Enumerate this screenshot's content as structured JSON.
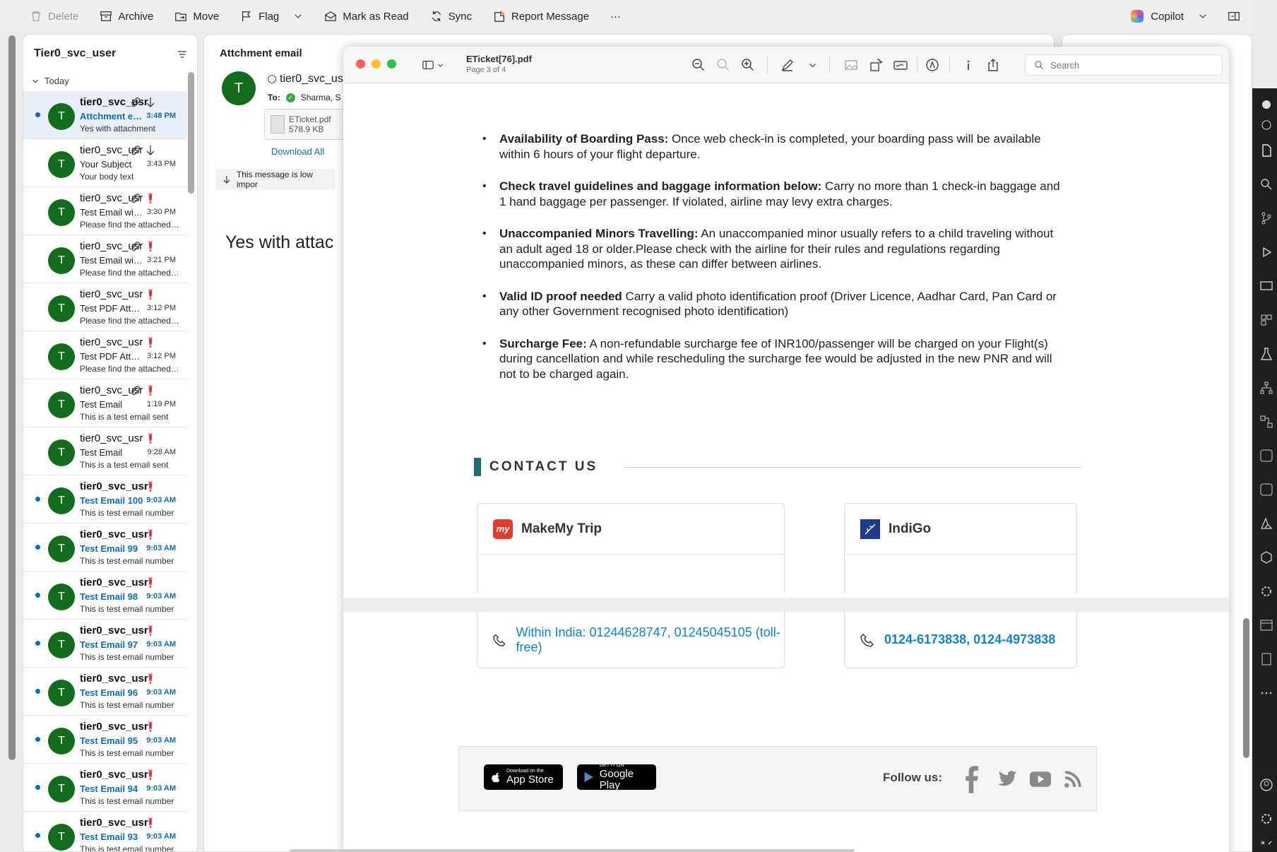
{
  "toolbar": {
    "delete": "Delete",
    "archive": "Archive",
    "move": "Move",
    "flag": "Flag",
    "mark_read": "Mark as Read",
    "sync": "Sync",
    "report": "Report Message",
    "more": "···",
    "copilot": "Copilot"
  },
  "list": {
    "title": "Tier0_svc_user",
    "group": "Today",
    "items": [
      {
        "sender": "tier0_svc_usr",
        "subject": "Attchment email",
        "time": "3:48 PM",
        "preview": "Yes with attachment",
        "unread": true,
        "selected": true,
        "attach": true,
        "download": true,
        "important": false
      },
      {
        "sender": "tier0_svc_usr",
        "subject": "Your Subject",
        "time": "3:43 PM",
        "preview": "Your body text",
        "unread": false,
        "selected": false,
        "attach": true,
        "download": true,
        "important": false
      },
      {
        "sender": "tier0_svc_usr",
        "subject": "Test Email with attachment",
        "time": "3:30 PM",
        "preview": "Please find the attached file",
        "unread": false,
        "selected": false,
        "attach": true,
        "download": false,
        "important": true
      },
      {
        "sender": "tier0_svc_usr",
        "subject": "Test Email with attachment",
        "time": "3:21 PM",
        "preview": "Please find the attached file",
        "unread": false,
        "selected": false,
        "attach": true,
        "download": false,
        "important": true
      },
      {
        "sender": "tier0_svc_usr",
        "subject": "Test PDF Attachment",
        "time": "3:12 PM",
        "preview": "Please find the attached file",
        "unread": false,
        "selected": false,
        "attach": false,
        "download": false,
        "important": true
      },
      {
        "sender": "tier0_svc_usr",
        "subject": "Test PDF Attachment",
        "time": "3:12 PM",
        "preview": "Please find the attached file",
        "unread": false,
        "selected": false,
        "attach": false,
        "download": false,
        "important": true
      },
      {
        "sender": "tier0_svc_usr",
        "subject": "Test Email",
        "time": "1:19 PM",
        "preview": "This is a test email sent",
        "unread": false,
        "selected": false,
        "attach": true,
        "download": false,
        "important": true
      },
      {
        "sender": "tier0_svc_usr",
        "subject": "Test Email",
        "time": "9:28 AM",
        "preview": "This is a test email sent",
        "unread": false,
        "selected": false,
        "attach": false,
        "download": false,
        "important": true
      },
      {
        "sender": "tier0_svc_usr",
        "subject": "Test Email 100",
        "time": "9:03 AM",
        "preview": "This is test email number",
        "unread": true,
        "selected": false,
        "attach": false,
        "download": false,
        "important": true
      },
      {
        "sender": "tier0_svc_usr",
        "subject": "Test Email 99",
        "time": "9:03 AM",
        "preview": "This is test email number",
        "unread": true,
        "selected": false,
        "attach": false,
        "download": false,
        "important": true
      },
      {
        "sender": "tier0_svc_usr",
        "subject": "Test Email 98",
        "time": "9:03 AM",
        "preview": "This is test email number",
        "unread": true,
        "selected": false,
        "attach": false,
        "download": false,
        "important": true
      },
      {
        "sender": "tier0_svc_usr",
        "subject": "Test Email 97",
        "time": "9:03 AM",
        "preview": "This is test email number",
        "unread": true,
        "selected": false,
        "attach": false,
        "download": false,
        "important": true
      },
      {
        "sender": "tier0_svc_usr",
        "subject": "Test Email 96",
        "time": "9:03 AM",
        "preview": "This is test email number",
        "unread": true,
        "selected": false,
        "attach": false,
        "download": false,
        "important": true
      },
      {
        "sender": "tier0_svc_usr",
        "subject": "Test Email 95",
        "time": "9:03 AM",
        "preview": "This is test email number",
        "unread": true,
        "selected": false,
        "attach": false,
        "download": false,
        "important": true
      },
      {
        "sender": "tier0_svc_usr",
        "subject": "Test Email 94",
        "time": "9:03 AM",
        "preview": "This is test email number",
        "unread": true,
        "selected": false,
        "attach": false,
        "download": false,
        "important": true
      },
      {
        "sender": "tier0_svc_usr",
        "subject": "Test Email 93",
        "time": "9:03 AM",
        "preview": "This is test email number",
        "unread": true,
        "selected": false,
        "attach": false,
        "download": false,
        "important": true
      }
    ]
  },
  "reading": {
    "title": "Attchment email",
    "avatar": "T",
    "from": "tier0_svc_us",
    "to_label": "To:",
    "to": "Sharma, S",
    "attachment_name": "ETicket.pdf",
    "attachment_size": "578.9 KB",
    "download_all": "Download All",
    "low_importance": "This message is low impor",
    "body": "Yes with attac"
  },
  "preview": {
    "filename": "ETicket[76].pdf",
    "page": "Page 3 of 4",
    "search_placeholder": "Search",
    "bullets": [
      {
        "bold": "Availability of Boarding Pass:",
        "text": " Once web check-in is completed, your boarding pass will be available within 6 hours of your flight departure."
      },
      {
        "bold": "Check travel guidelines and baggage information below:",
        "text": " Carry no more than 1 check-in baggage and 1 hand baggage per passenger. If violated, airline may levy extra charges."
      },
      {
        "bold": "Unaccompanied Minors Travelling:",
        "text": " An unaccompanied minor usually refers to a child traveling without an adult aged 18 or older.Please check with the airline for their rules and regulations regarding unaccompanied minors, as these can differ between airlines."
      },
      {
        "bold": "Valid ID proof needed",
        "text": " Carry a valid photo identification proof (Driver Licence, Aadhar Card, Pan Card or any other Government recognised photo identification)"
      },
      {
        "bold": "Surcharge Fee:",
        "text": " A non-refundable surcharge fee of INR100/passenger will be charged on your Flight(s) during cancellation and while rescheduling the surcharge fee would be adjusted in the new PNR and will not to be charged again."
      }
    ],
    "contact_title": "CONTACT US",
    "card_mmt": "MakeMy Trip",
    "card_indigo": "IndiGo",
    "mmt_logo": "my",
    "phone_mmt": "Within India: 01244628747, 01245045105 (toll-free)",
    "phone_indigo": "0124-6173838, 0124-4973838",
    "appstore_small": "Download on the",
    "appstore_big": "App Store",
    "gplay_small": "GET IT ON",
    "gplay_big": "Google Play",
    "follow": "Follow us:"
  },
  "colors": {
    "accent": "#0f6cbd",
    "avatar": "#116c1c",
    "important": "#d13438",
    "contact_bar": "#1b6f68"
  }
}
